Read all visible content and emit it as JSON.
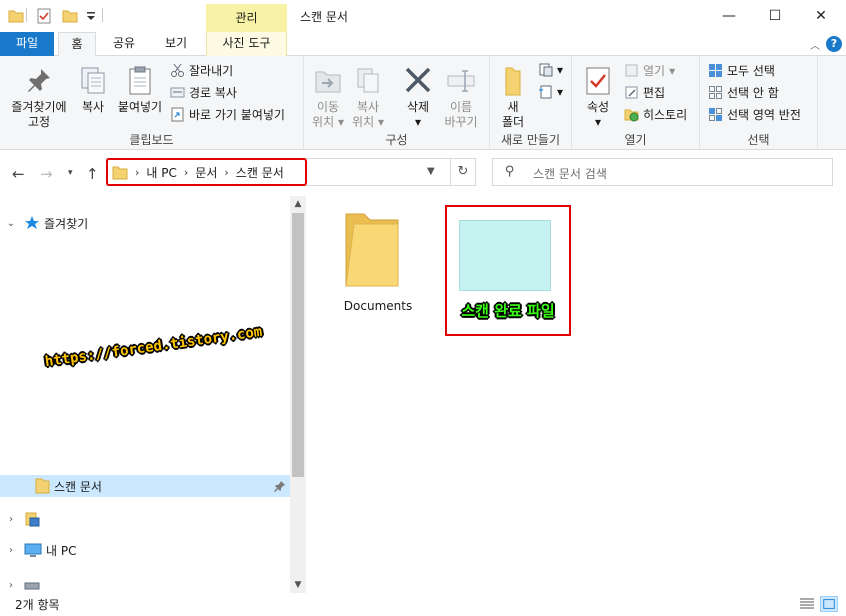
{
  "titlebar": {
    "manage_tab": "관리",
    "title": "스캔 문서",
    "minimize_glyph": "—",
    "maximize_glyph": "☐",
    "close_glyph": "✕"
  },
  "tabs": {
    "file": "파일",
    "home": "홈",
    "share": "공유",
    "view": "보기",
    "picture_tools": "사진 도구",
    "collapse_glyph": "︿",
    "help_glyph": "?"
  },
  "ribbon": {
    "clipboard": {
      "pin_line1": "즐겨찾기에",
      "pin_line2": "고정",
      "copy": "복사",
      "paste": "붙여넣기",
      "cut": "잘라내기",
      "copy_path": "경로 복사",
      "paste_shortcut": "바로 가기 붙여넣기",
      "group": "클립보드"
    },
    "organize": {
      "move_to_line1": "이동",
      "move_to_line2": "위치",
      "copy_to_line1": "복사",
      "copy_to_line2": "위치",
      "delete": "삭제",
      "rename_line1": "이름",
      "rename_line2": "바꾸기",
      "group": "구성"
    },
    "new": {
      "new_folder_line1": "새",
      "new_folder_line2": "폴더",
      "group": "새로 만들기"
    },
    "open": {
      "properties": "속성",
      "open": "열기",
      "edit": "편집",
      "history": "히스토리",
      "group": "열기"
    },
    "select": {
      "select_all": "모두 선택",
      "select_none": "선택 안 함",
      "invert": "선택 영역 반전",
      "group": "선택"
    }
  },
  "address": {
    "crumbs": [
      "내 PC",
      "문서",
      "스캔 문서"
    ],
    "refresh_glyph": "↻",
    "search_placeholder": "스캔 문서 검색"
  },
  "navpane": {
    "quick_access": "즐겨찾기",
    "scan_folder": "스캔 문서",
    "this_pc": "내 PC"
  },
  "content": {
    "items": [
      {
        "name": "Documents"
      },
      {
        "name": "스캔 완료 파일"
      }
    ]
  },
  "watermark": "https://forced.tistory.com",
  "status": {
    "item_count": "2개 항목"
  },
  "colors": {
    "accent": "#1979ca",
    "picture_tools": "#f7f2a6",
    "highlight_box": "#e00000",
    "selected_row": "#cce8ff",
    "thumbnail": "#c5f2f1",
    "file_label": "#39ff14",
    "watermark": "#ffc400"
  }
}
